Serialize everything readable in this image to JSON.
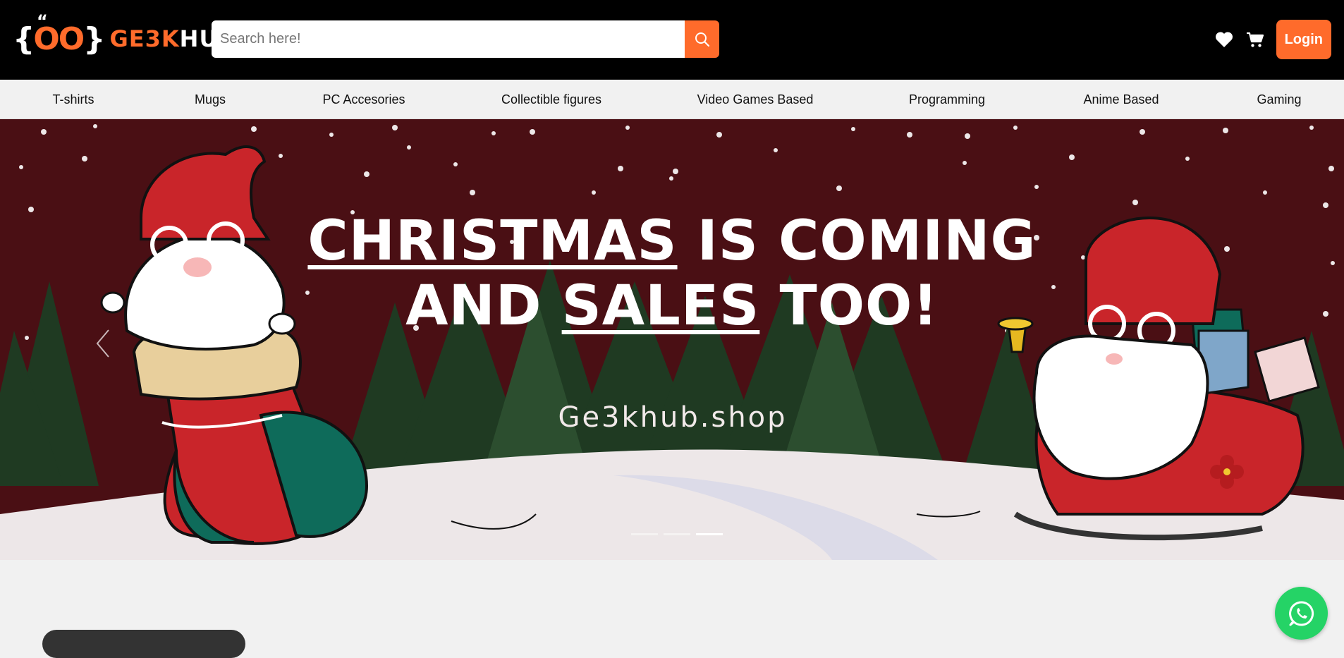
{
  "header": {
    "logo": {
      "mark": "{OO}",
      "text_accent": "GE3K",
      "text_main": "HUB"
    },
    "search": {
      "placeholder": "Search here!",
      "value": ""
    },
    "icons": [
      "heart-icon",
      "cart-icon"
    ],
    "login_label": "Login",
    "accent_color": "#ff6b2b"
  },
  "categories": [
    {
      "label": "T-shirts"
    },
    {
      "label": "Mugs"
    },
    {
      "label": "PC Accesories"
    },
    {
      "label": "Collectible figures"
    },
    {
      "label": "Video Games Based"
    },
    {
      "label": "Programming"
    },
    {
      "label": "Anime Based"
    },
    {
      "label": "Gaming"
    }
  ],
  "banner": {
    "line1_underlined": "CHRISTMAS",
    "line1_rest": " IS COMING",
    "line2_start": "AND ",
    "line2_underlined": "SALES",
    "line2_end": " TOO!",
    "site": "Ge3khub.shop",
    "slides": 3,
    "active_slide": 3
  },
  "whatsapp": {
    "icon": "whatsapp-icon",
    "color": "#25d366"
  }
}
